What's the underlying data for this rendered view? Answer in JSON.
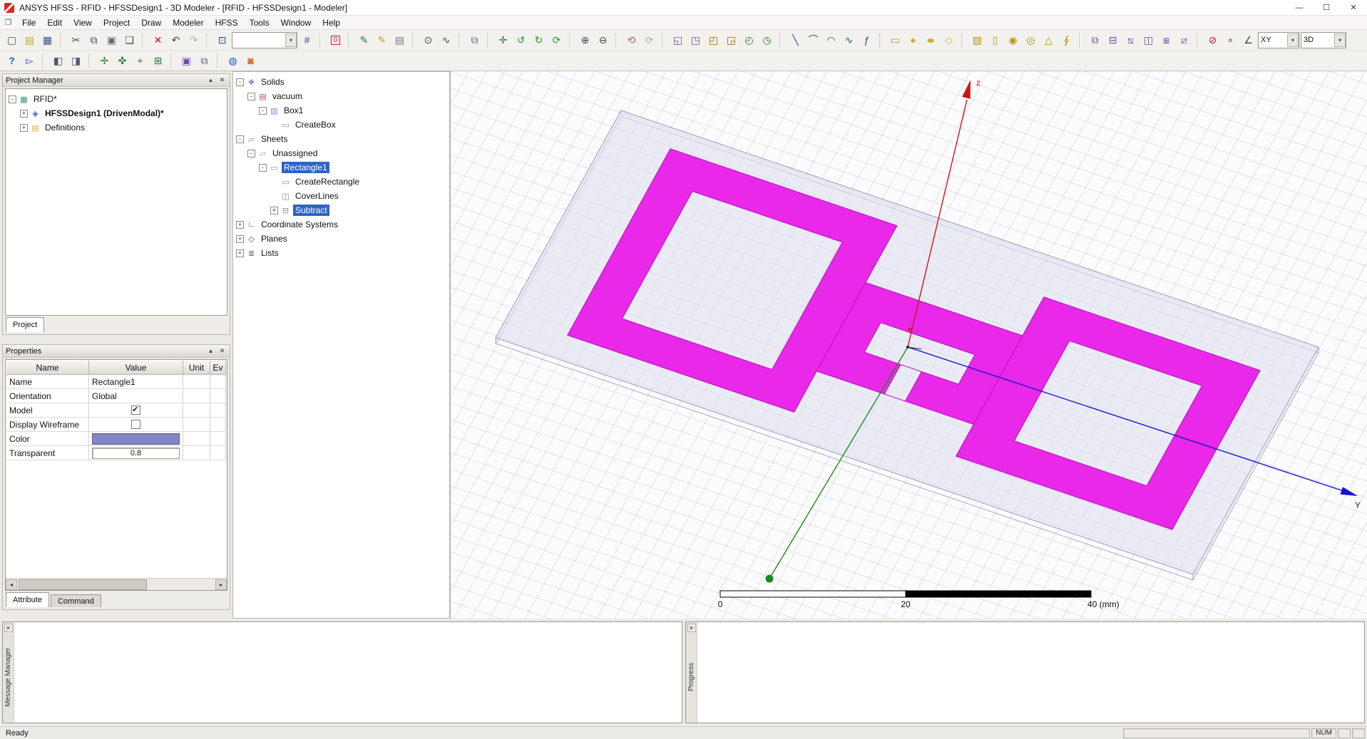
{
  "window": {
    "title": "ANSYS HFSS - RFID - HFSSDesign1 - 3D Modeler - [RFID - HFSSDesign1 - Modeler]",
    "controls": [
      {
        "name": "minimize-button",
        "glyph": "—"
      },
      {
        "name": "maximize-button",
        "glyph": "☐"
      },
      {
        "name": "close-button",
        "glyph": "✕"
      }
    ]
  },
  "menubar": {
    "items": [
      "File",
      "Edit",
      "View",
      "Project",
      "Draw",
      "Modeler",
      "HFSS",
      "Tools",
      "Window",
      "Help"
    ]
  },
  "toolbar_main": {
    "items": [
      {
        "name": "new-file-icon",
        "glyph": "▢",
        "color": "#555555"
      },
      {
        "name": "open-file-icon",
        "glyph": "▤",
        "color": "#c9a227"
      },
      {
        "name": "save-icon",
        "glyph": "▦",
        "color": "#33528a"
      },
      {
        "name": "toolbar-separator",
        "cls": "sep"
      },
      {
        "name": "cut-icon",
        "glyph": "✂",
        "color": "#444444"
      },
      {
        "name": "copy-icon",
        "glyph": "⧉",
        "color": "#444444"
      },
      {
        "name": "paste-icon",
        "glyph": "▣",
        "color": "#666666"
      },
      {
        "name": "print-icon",
        "glyph": "❑",
        "color": "#444444"
      },
      {
        "name": "toolbar-separator",
        "cls": "sep"
      },
      {
        "name": "delete-icon",
        "glyph": "✕",
        "color": "#cc1111"
      },
      {
        "name": "undo-icon",
        "glyph": "↶",
        "color": "#444444"
      },
      {
        "name": "redo-icon",
        "glyph": "↷",
        "color": "#aaaaaa"
      },
      {
        "name": "toolbar-separator",
        "cls": "sep"
      },
      {
        "name": "select-object-icon",
        "glyph": "⊡",
        "color": "#2a4d8f"
      },
      {
        "name": "selection-mode-combo",
        "cls": "combo",
        "label": ""
      },
      {
        "name": "snap-mode-icon",
        "glyph": "#",
        "color": "#2a4d8f"
      },
      {
        "name": "toolbar-separator",
        "cls": "sep"
      },
      {
        "name": "zero-order-icon",
        "glyph": "0",
        "color": "#cc2222",
        "cls": "boxed"
      },
      {
        "name": "toolbar-separator",
        "cls": "sep"
      },
      {
        "name": "script-record-icon",
        "glyph": "✎",
        "color": "#2a7a2a"
      },
      {
        "name": "script-play-icon",
        "glyph": "✎",
        "color": "#c9a227"
      },
      {
        "name": "report-icon",
        "glyph": "▤",
        "color": "#777777"
      },
      {
        "name": "toolbar-separator",
        "cls": "sep"
      },
      {
        "name": "magnifier-icon",
        "glyph": "⊙",
        "color": "#444444"
      },
      {
        "name": "plot-icon",
        "glyph": "∿",
        "color": "#444444"
      },
      {
        "name": "toolbar-separator",
        "cls": "sep"
      },
      {
        "name": "copy-image-icon",
        "glyph": "⧉",
        "color": "#666677"
      },
      {
        "name": "toolbar-separator",
        "cls": "sep"
      },
      {
        "name": "pan-icon",
        "glyph": "✛",
        "color": "#2a7a2a"
      },
      {
        "name": "rotate-model-center-icon",
        "glyph": "↺",
        "color": "#2a9a2a"
      },
      {
        "name": "rotate-current-axis-icon",
        "glyph": "↻",
        "color": "#2a9a2a"
      },
      {
        "name": "dynamic-rotate-icon",
        "glyph": "⟳",
        "color": "#2a9a2a"
      },
      {
        "name": "toolbar-separator",
        "cls": "sep"
      },
      {
        "name": "zoom-in-icon",
        "glyph": "⊕",
        "color": "#444444"
      },
      {
        "name": "zoom-out-icon",
        "glyph": "⊖",
        "color": "#444444"
      },
      {
        "name": "toolbar-separator",
        "cls": "sep"
      },
      {
        "name": "view-undo-icon",
        "glyph": "⟲",
        "color": "#aa6666"
      },
      {
        "name": "view-redo-icon",
        "glyph": "⟳",
        "color": "#aaaaaa"
      },
      {
        "name": "toolbar-separator",
        "cls": "sep"
      },
      {
        "name": "fit-all-icon",
        "glyph": "◱",
        "color": "#8844aa"
      },
      {
        "name": "fit-selection-icon",
        "glyph": "◳",
        "color": "#8844aa"
      },
      {
        "name": "orient-top-icon",
        "glyph": "◰",
        "color": "#aa6600"
      },
      {
        "name": "orient-bottom-icon",
        "glyph": "◲",
        "color": "#aa6600"
      },
      {
        "name": "orient-isometric-icon",
        "glyph": "◴",
        "color": "#2a7a2a"
      },
      {
        "name": "orient-back-icon",
        "glyph": "◷",
        "color": "#2a7a2a"
      },
      {
        "name": "toolbar-separator",
        "cls": "sep"
      },
      {
        "name": "draw-line-icon",
        "glyph": "╲",
        "color": "#234e8a"
      },
      {
        "name": "draw-arc-icon",
        "glyph": "⌒",
        "color": "#234e8a"
      },
      {
        "name": "draw-center-arc-icon",
        "glyph": "◠",
        "color": "#234e8a"
      },
      {
        "name": "draw-spline-icon",
        "glyph": "∿",
        "color": "#234e8a"
      },
      {
        "name": "draw-equation-curve-icon",
        "glyph": "ƒ",
        "color": "#234e8a"
      },
      {
        "name": "toolbar-separator",
        "cls": "sep"
      },
      {
        "name": "draw-rectangle-icon",
        "glyph": "▭",
        "color": "#b59410"
      },
      {
        "name": "draw-circle-icon",
        "glyph": "●",
        "color": "#c9b037"
      },
      {
        "name": "draw-ellipse-icon",
        "glyph": "●",
        "color": "#c9b037",
        "cls": "wide"
      },
      {
        "name": "draw-polygon-icon",
        "glyph": "◇",
        "color": "#c9b037"
      },
      {
        "name": "toolbar-separator",
        "cls": "sep"
      },
      {
        "name": "draw-box-icon",
        "glyph": "▧",
        "color": "#b59410"
      },
      {
        "name": "draw-cylinder-icon",
        "glyph": "▯",
        "color": "#b59410"
      },
      {
        "name": "draw-sphere-icon",
        "glyph": "◉",
        "color": "#b59410"
      },
      {
        "name": "draw-torus-icon",
        "glyph": "◎",
        "color": "#b59410"
      },
      {
        "name": "draw-cone-icon",
        "glyph": "△",
        "color": "#b59410"
      },
      {
        "name": "draw-helix-icon",
        "glyph": "∮",
        "color": "#b59410"
      },
      {
        "name": "toolbar-separator",
        "cls": "sep"
      },
      {
        "name": "unite-icon",
        "glyph": "⧉",
        "color": "#6a4fa3"
      },
      {
        "name": "subtract-icon",
        "glyph": "⊟",
        "color": "#6a4fa3"
      },
      {
        "name": "intersect-icon",
        "glyph": "⧅",
        "color": "#6a4fa3"
      },
      {
        "name": "split-icon",
        "glyph": "◫",
        "color": "#6a4fa3"
      },
      {
        "name": "imprint-icon",
        "glyph": "⧆",
        "color": "#6a4fa3"
      },
      {
        "name": "sweep-icon",
        "glyph": "⧄",
        "color": "#6a4fa3"
      },
      {
        "name": "toolbar-separator",
        "cls": "sep"
      },
      {
        "name": "non-model-icon",
        "glyph": "⊘",
        "color": "#cc2222"
      },
      {
        "name": "vertex-mode-icon",
        "glyph": "∘",
        "color": "#444444"
      },
      {
        "name": "measure-icon",
        "glyph": "∠",
        "color": "#444444"
      },
      {
        "name": "working-plane-combo",
        "cls": "combo sm",
        "label": "XY"
      },
      {
        "name": "view-dimension-combo",
        "cls": "combo sm2",
        "label": "3D"
      }
    ]
  },
  "toolbar_secondary": {
    "items": [
      {
        "name": "context-help-icon",
        "glyph": "?",
        "color": "#2255cc",
        "cls": "bold"
      },
      {
        "name": "select-pointer-icon",
        "glyph": "▻",
        "color": "#2255cc"
      },
      {
        "name": "toolbar-separator",
        "cls": "sep"
      },
      {
        "name": "show-project-manager-icon",
        "glyph": "◧",
        "color": "#555566"
      },
      {
        "name": "show-properties-icon",
        "glyph": "◨",
        "color": "#555566"
      },
      {
        "name": "toolbar-separator",
        "cls": "sep"
      },
      {
        "name": "snap-vertex-icon",
        "glyph": "✛",
        "color": "#2a7a2a"
      },
      {
        "name": "snap-edge-icon",
        "glyph": "✜",
        "color": "#2a7a2a"
      },
      {
        "name": "snap-center-icon",
        "glyph": "⌖",
        "color": "#2a7a2a"
      },
      {
        "name": "snap-grid-icon",
        "glyph": "⊞",
        "color": "#2a7a2a"
      },
      {
        "name": "toolbar-separator",
        "cls": "sep"
      },
      {
        "name": "align-icon",
        "glyph": "▣",
        "color": "#6a4fa3"
      },
      {
        "name": "array-icon",
        "glyph": "⧉",
        "color": "#6a4fa3"
      },
      {
        "name": "toolbar-separator",
        "cls": "sep"
      },
      {
        "name": "world-cs-icon",
        "glyph": "◍",
        "color": "#2255cc"
      },
      {
        "name": "material-browser-icon",
        "glyph": "◙",
        "color": "#cc6622"
      }
    ]
  },
  "project_manager": {
    "title": "Project Manager",
    "tree": [
      {
        "name": "tree-item-project-rfid",
        "depth": 0,
        "expand": "-",
        "icon": "▦",
        "icolor": "#2e9a6b",
        "label": "RFID*",
        "cls": ""
      },
      {
        "name": "tree-item-hfssdesign1",
        "depth": 1,
        "expand": "+",
        "icon": "◈",
        "icolor": "#3a62c0",
        "label": "HFSSDesign1 (DrivenModal)*",
        "cls": "bold"
      },
      {
        "name": "tree-item-definitions",
        "depth": 1,
        "expand": "+",
        "icon": "▤",
        "icolor": "#d9b13b",
        "label": "Definitions",
        "cls": ""
      }
    ],
    "tab": "Project"
  },
  "properties_panel": {
    "title": "Properties",
    "columns": [
      "Name",
      "Value",
      "Unit",
      "Ev"
    ],
    "rows": [
      {
        "name": "Name",
        "value": "Rectangle1"
      },
      {
        "name": "Orientation",
        "value": "Global"
      },
      {
        "name": "Model",
        "value": "checked"
      },
      {
        "name": "Display Wireframe",
        "value": "unchecked"
      },
      {
        "name": "Color",
        "value": "#8585c9"
      },
      {
        "name": "Transparent",
        "value": "0.8"
      }
    ],
    "tabs": [
      "Attribute",
      "Command"
    ]
  },
  "modeler_tree": {
    "items": [
      {
        "name": "tree-item-solids",
        "depth": 0,
        "expand": "-",
        "icon": "❖",
        "icolor": "#7b7fae",
        "label": "Solids",
        "cls": ""
      },
      {
        "name": "tree-item-vacuum",
        "depth": 1,
        "expand": "-",
        "icon": "▤",
        "icolor": "#c05050",
        "label": "vacuum",
        "cls": ""
      },
      {
        "name": "tree-item-box1",
        "depth": 2,
        "expand": "-",
        "icon": "▧",
        "icolor": "#8a8ace",
        "label": "Box1",
        "cls": ""
      },
      {
        "name": "tree-item-createbox",
        "depth": 3,
        "expand": "",
        "icon": "▭",
        "icolor": "#8a8a8a",
        "label": "CreateBox",
        "cls": ""
      },
      {
        "name": "tree-item-sheets",
        "depth": 0,
        "expand": "-",
        "icon": "▱",
        "icolor": "#7b7fae",
        "label": "Sheets",
        "cls": ""
      },
      {
        "name": "tree-item-unassigned",
        "depth": 1,
        "expand": "-",
        "icon": "▱",
        "icolor": "#9a9ab8",
        "label": "Unassigned",
        "cls": ""
      },
      {
        "name": "tree-item-rectangle1",
        "depth": 2,
        "expand": "-",
        "icon": "▭",
        "icolor": "#8a8ace",
        "label": "Rectangle1",
        "cls": "sel"
      },
      {
        "name": "tree-item-createrectangle",
        "depth": 3,
        "expand": "",
        "icon": "▭",
        "icolor": "#8a8a8a",
        "label": "CreateRectangle",
        "cls": ""
      },
      {
        "name": "tree-item-coverlines",
        "depth": 3,
        "expand": "",
        "icon": "◫",
        "icolor": "#8a8a8a",
        "label": "CoverLines",
        "cls": ""
      },
      {
        "name": "tree-item-subtract",
        "depth": 3,
        "expand": "+",
        "icon": "⊟",
        "icolor": "#8a8a8a",
        "label": "Subtract",
        "cls": "sel"
      },
      {
        "name": "tree-item-coordinate-systems",
        "depth": 0,
        "expand": "+",
        "icon": "∟",
        "icolor": "#555555",
        "label": "Coordinate Systems",
        "cls": ""
      },
      {
        "name": "tree-item-planes",
        "depth": 0,
        "expand": "+",
        "icon": "◇",
        "icolor": "#555555",
        "label": "Planes",
        "cls": ""
      },
      {
        "name": "tree-item-lists",
        "depth": 0,
        "expand": "+",
        "icon": "≣",
        "icolor": "#555555",
        "label": "Lists",
        "cls": ""
      }
    ]
  },
  "viewport": {
    "colors": {
      "antenna": "#e91ee9",
      "substrate": "#dfdff2",
      "axis_x": "#1a8a1a",
      "axis_y": "#1515cc",
      "axis_z": "#cc1515"
    },
    "axis_labels": {
      "z": "z",
      "y": "Y"
    },
    "scale_bar": {
      "labels": [
        "0",
        "20",
        "40 (mm)"
      ]
    }
  },
  "message_manager": {
    "label": "Message Manager"
  },
  "progress": {
    "label": "Progress"
  },
  "statusbar": {
    "ready": "Ready",
    "num": "NUM"
  },
  "ui": {
    "collapse_glyph": "▴",
    "close_glyph": "✕"
  }
}
